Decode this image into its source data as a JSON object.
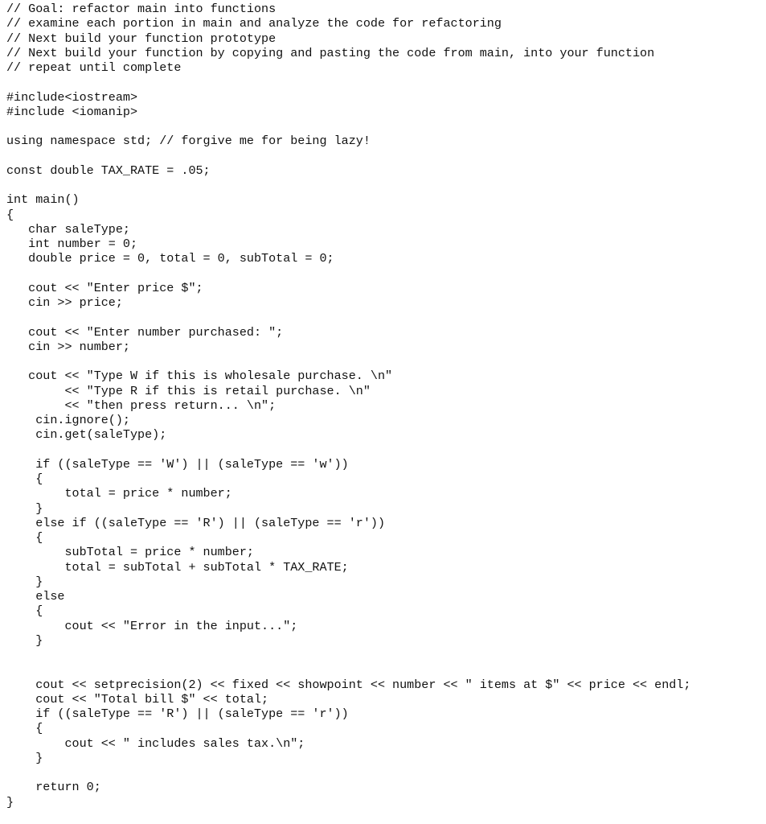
{
  "document": {
    "language": "C++",
    "lines": [
      "// Goal: refactor main into functions",
      "// examine each portion in main and analyze the code for refactoring",
      "// Next build your function prototype",
      "// Next build your function by copying and pasting the code from main, into your function",
      "// repeat until complete",
      "",
      "#include<iostream>",
      "#include <iomanip>",
      "",
      "using namespace std; // forgive me for being lazy!",
      "",
      "const double TAX_RATE = .05;",
      "",
      "int main()",
      "{",
      "   char saleType;",
      "   int number = 0;",
      "   double price = 0, total = 0, subTotal = 0;",
      "",
      "   cout << \"Enter price $\";",
      "   cin >> price;",
      "",
      "   cout << \"Enter number purchased: \";",
      "   cin >> number;",
      "",
      "   cout << \"Type W if this is wholesale purchase. \\n\"",
      "        << \"Type R if this is retail purchase. \\n\"",
      "        << \"then press return... \\n\";",
      "    cin.ignore();",
      "    cin.get(saleType);",
      "",
      "    if ((saleType == 'W') || (saleType == 'w'))",
      "    {",
      "        total = price * number;",
      "    }",
      "    else if ((saleType == 'R') || (saleType == 'r'))",
      "    {",
      "        subTotal = price * number;",
      "        total = subTotal + subTotal * TAX_RATE;",
      "    }",
      "    else",
      "    {",
      "        cout << \"Error in the input...\";",
      "    }",
      "",
      "",
      "    cout << setprecision(2) << fixed << showpoint << number << \" items at $\" << price << endl;",
      "    cout << \"Total bill $\" << total;",
      "    if ((saleType == 'R') || (saleType == 'r'))",
      "    {",
      "        cout << \" includes sales tax.\\n\";",
      "    }",
      "",
      "    return 0;",
      "}"
    ]
  }
}
